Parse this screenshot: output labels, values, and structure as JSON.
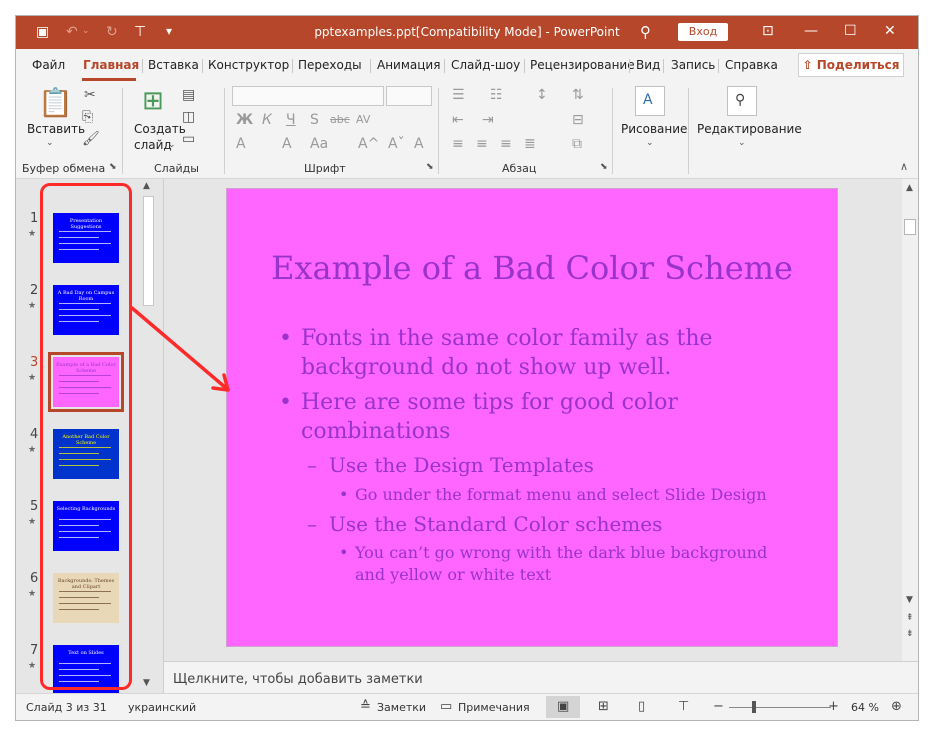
{
  "window": {
    "title": "pptexamples.ppt[Compatibility Mode]  -  PowerPoint",
    "login_label": "Вход",
    "accent": "#b7472a"
  },
  "tabs": [
    "Файл",
    "Главная",
    "Вставка",
    "Конструктор",
    "Переходы",
    "Анимация",
    "Слайд-шоу",
    "Рецензирование",
    "Вид",
    "Запись",
    "Справка"
  ],
  "active_tab": "Главная",
  "share_label": "Поделиться",
  "ribbon": {
    "clipboard": {
      "paste_label": "Вставить",
      "group_label": "Буфер обмена"
    },
    "slides": {
      "new_label_1": "Создать",
      "new_label_2": "слайд",
      "group_label": "Слайды"
    },
    "font": {
      "group_label": "Шрифт",
      "bold": "Ж",
      "italic": "К",
      "underline": "Ч",
      "strike": "S",
      "shadow": "abc",
      "spacing": "AV",
      "grow": "A^",
      "shrink": "Aˇ",
      "case": "Aa",
      "clear": "A"
    },
    "paragraph": {
      "group_label": "Абзац"
    },
    "drawing": {
      "label": "Рисование"
    },
    "editing": {
      "label": "Редактирование"
    }
  },
  "thumbnails": [
    {
      "num": "1",
      "title": "Presentation Suggestions",
      "bg": "#0000ff",
      "fg": "#ffffff"
    },
    {
      "num": "2",
      "title": "A Bad Day on Campus Room",
      "bg": "#0000ff",
      "fg": "#ffffff"
    },
    {
      "num": "3",
      "title": "Example of a Bad Color Scheme",
      "bg": "#ff66ff",
      "fg": "#9933cc",
      "selected": true
    },
    {
      "num": "4",
      "title": "Another Bad Color Scheme",
      "bg": "#0033cc",
      "fg": "#ffff00"
    },
    {
      "num": "5",
      "title": "Selecting Backgrounds",
      "bg": "#0000ff",
      "fg": "#ffffff"
    },
    {
      "num": "6",
      "title": "Backgrounds: Themes and Clipart",
      "bg": "#e8d8b8",
      "fg": "#664422"
    },
    {
      "num": "7",
      "title": "Text on Slides",
      "bg": "#0000ff",
      "fg": "#ffffff"
    }
  ],
  "slide": {
    "title": "Example of a Bad Color Scheme",
    "bullets": [
      {
        "level": 1,
        "lines": [
          "Fonts in the same color family as the",
          "background do not show up well."
        ]
      },
      {
        "level": 1,
        "lines": [
          "Here are some tips for good color",
          "combinations"
        ]
      },
      {
        "level": 2,
        "lines": [
          "Use the Design Templates"
        ]
      },
      {
        "level": 3,
        "lines": [
          "Go under the format menu and select Slide Design"
        ]
      },
      {
        "level": 2,
        "lines": [
          "Use the Standard Color schemes"
        ]
      },
      {
        "level": 3,
        "lines": [
          "You can’t go wrong with the dark blue background",
          "and yellow or white text"
        ]
      }
    ],
    "bg": "#ff66ff",
    "text_color": "#9933cc"
  },
  "notes_placeholder": "Щелкните, чтобы добавить заметки",
  "status": {
    "slide_info": "Слайд 3 из 31",
    "language": "украинский",
    "notes_label": "Заметки",
    "comments_label": "Примечания",
    "zoom": "64 %",
    "zoom_level": 0.23
  },
  "annotation_color": "#ff2a2a"
}
